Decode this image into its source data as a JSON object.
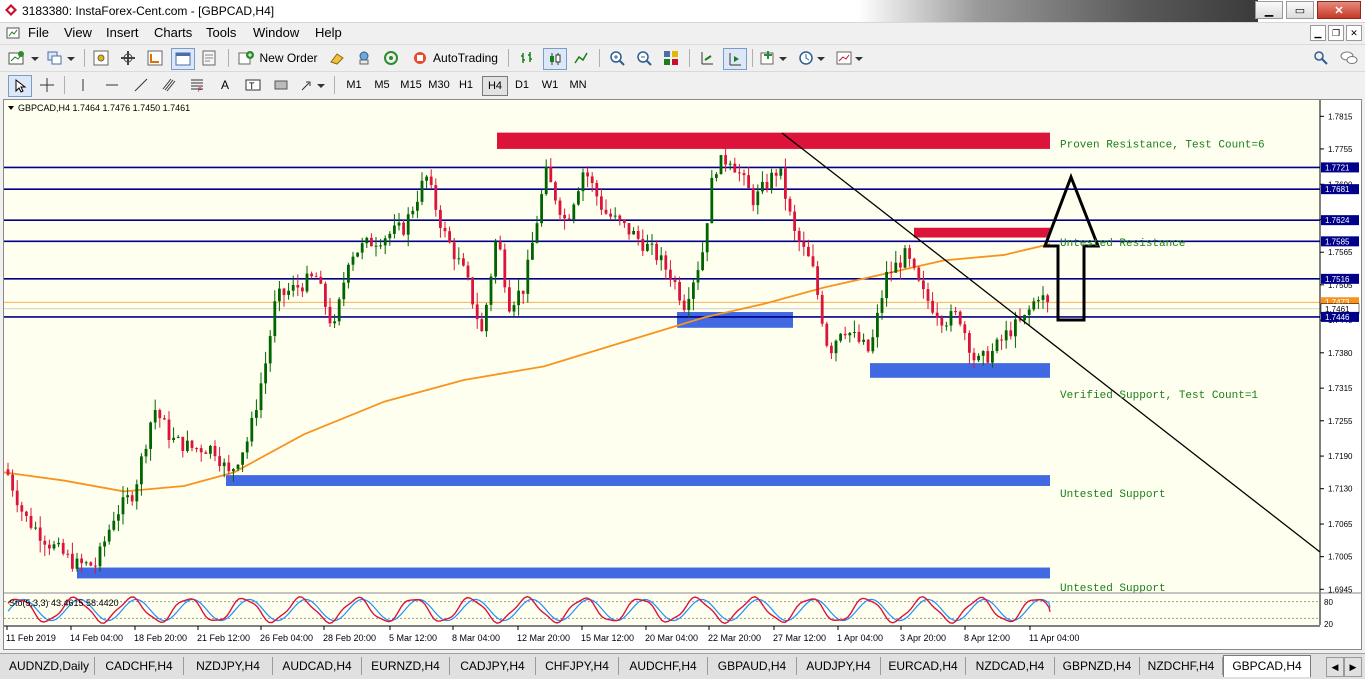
{
  "window": {
    "title": "3183380: InstaForex-Cent.com - [GBPCAD,H4]"
  },
  "menu": [
    "File",
    "View",
    "Insert",
    "Charts",
    "Tools",
    "Window",
    "Help"
  ],
  "toolbar": {
    "new_order": "New Order",
    "autotrading": "AutoTrading"
  },
  "timeframes": [
    "M1",
    "M5",
    "M15",
    "M30",
    "H1",
    "H4",
    "D1",
    "W1",
    "MN"
  ],
  "selected_timeframe": "H4",
  "chart": {
    "header": "GBPCAD,H4  1.7464 1.7476 1.7450 1.7461",
    "price_ticks": [
      "1.7815",
      "1.7755",
      "1.7690",
      "1.7625",
      "1.7565",
      "1.7505",
      "1.7440",
      "1.7380",
      "1.7315",
      "1.7255",
      "1.7190",
      "1.7130",
      "1.7065",
      "1.7005",
      "1.6945"
    ],
    "level_labels": [
      "1.7721",
      "1.7681",
      "1.7624",
      "1.7585",
      "1.7516",
      "1.7473",
      "1.7461",
      "1.7446"
    ],
    "time_labels": [
      "11 Feb 2019",
      "14 Feb 04:00",
      "18 Feb 20:00",
      "21 Feb 12:00",
      "26 Feb 04:00",
      "28 Feb 20:00",
      "5 Mar 12:00",
      "8 Mar 04:00",
      "12 Mar 20:00",
      "15 Mar 12:00",
      "20 Mar 04:00",
      "22 Mar 20:00",
      "27 Mar 12:00",
      "1 Apr 04:00",
      "3 Apr 20:00",
      "8 Apr 12:00",
      "11 Apr 04:00"
    ],
    "zone_labels": [
      "Proven Resistance, Test Count=6",
      "Untested Resistance",
      "Verified Support, Test Count=1",
      "Untested Support",
      "Untested Support"
    ],
    "stoch_label": "Sto(5,3,3) 43.4615 58.4420",
    "stoch_ticks": [
      "80",
      "20"
    ]
  },
  "tabs": [
    "AUDNZD,Daily",
    "CADCHF,H4",
    "NZDJPY,H4",
    "AUDCAD,H4",
    "EURNZD,H4",
    "CADJPY,H4",
    "CHFJPY,H4",
    "AUDCHF,H4",
    "GBPAUD,H4",
    "AUDJPY,H4",
    "EURCAD,H4",
    "NZDCAD,H4",
    "GBPNZD,H4",
    "NZDCHF,H4",
    "GBPCAD,H4"
  ],
  "active_tab": "GBPCAD,H4",
  "chart_data": {
    "type": "candlestick",
    "symbol": "GBPCAD",
    "timeframe": "H4",
    "last_bar": {
      "open": 1.7464,
      "high": 1.7476,
      "low": 1.745,
      "close": 1.7461
    },
    "ylim": [
      1.694,
      1.7845
    ],
    "y_ticks": [
      1.7815,
      1.7755,
      1.769,
      1.7625,
      1.7565,
      1.7505,
      1.744,
      1.738,
      1.7315,
      1.7255,
      1.719,
      1.713,
      1.7065,
      1.7005,
      1.6945
    ],
    "x_labels": [
      "11 Feb 2019",
      "14 Feb 04:00",
      "18 Feb 20:00",
      "21 Feb 12:00",
      "26 Feb 04:00",
      "28 Feb 20:00",
      "5 Mar 12:00",
      "8 Mar 04:00",
      "12 Mar 20:00",
      "15 Mar 12:00",
      "20 Mar 04:00",
      "22 Mar 20:00",
      "27 Mar 12:00",
      "1 Apr 04:00",
      "3 Apr 20:00",
      "8 Apr 12:00",
      "11 Apr 04:00"
    ],
    "horizontal_levels": [
      1.7721,
      1.7681,
      1.7624,
      1.7585,
      1.7516,
      1.7446
    ],
    "bid": 1.7461,
    "ask": 1.7473,
    "zones": [
      {
        "label": "Proven Resistance, Test Count=6",
        "kind": "resistance",
        "color": "#dc143c",
        "from": 1.7785,
        "to": 1.7755
      },
      {
        "label": "Untested Resistance",
        "kind": "resistance",
        "color": "#dc143c",
        "from": 1.761,
        "to": 1.7592
      },
      {
        "label": "Verified Support, Test Count=1",
        "kind": "support",
        "color": "#4169e1",
        "from": 1.7361,
        "to": 1.7334
      },
      {
        "label": "Untested Support",
        "kind": "support",
        "color": "#4169e1",
        "from": 1.7155,
        "to": 1.7135
      },
      {
        "label": "Untested Support",
        "kind": "support",
        "color": "#4169e1",
        "from": 1.6985,
        "to": 1.6965
      }
    ],
    "moving_average_color": "#f7931e",
    "candle_up_color": "#006400",
    "candle_down_color": "#dc143c",
    "stochastic": {
      "params": "5,3,3",
      "main": 43.4615,
      "signal": 58.442,
      "levels": [
        80,
        20
      ],
      "main_color": "#dc143c",
      "signal_color": "#1e90ff"
    }
  }
}
